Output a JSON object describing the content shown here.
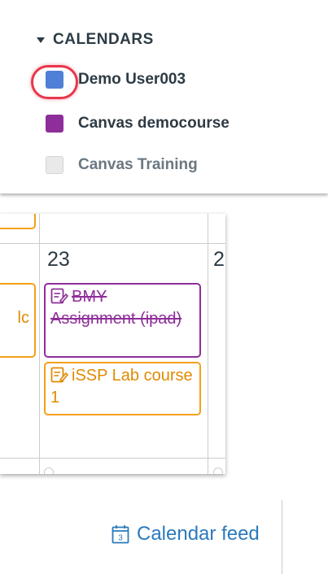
{
  "calendars": {
    "header": "CALENDARS",
    "items": [
      {
        "label": "Demo User003",
        "color": "#4f7fd6",
        "checked": true,
        "highlighted": true
      },
      {
        "label": "Canvas democourse",
        "color": "#8e2e9a",
        "checked": true
      },
      {
        "label": "Canvas Training",
        "color": "#e6e6e6",
        "checked": false
      }
    ]
  },
  "grid": {
    "day_number": "23",
    "next_day_partial": "2",
    "left_event_partial": "lc",
    "events": [
      {
        "title": "BMY Assignment (ipad)",
        "color": "#8e2e9a",
        "completed": true,
        "icon": "assignment-icon"
      },
      {
        "title": "iSSP Lab course 1",
        "color": "#f5a019",
        "completed": false,
        "icon": "assignment-icon"
      }
    ]
  },
  "feed": {
    "label": "Calendar feed",
    "icon_digit": "3"
  },
  "colors": {
    "highlight": "#e8374a",
    "link": "#2b7abc",
    "text": "#2d3b45"
  }
}
